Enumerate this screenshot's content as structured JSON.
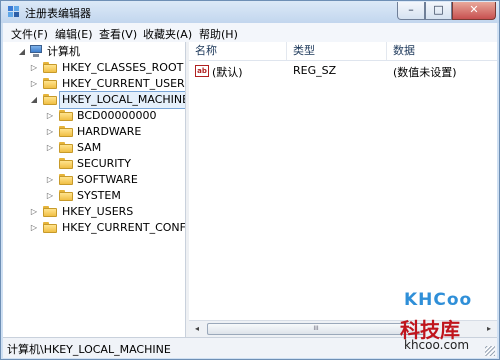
{
  "window": {
    "title": "注册表编辑器",
    "controls": {
      "minimize": "–",
      "maximize": "□",
      "close": "✕"
    }
  },
  "menu": [
    "文件(F)",
    "编辑(E)",
    "查看(V)",
    "收藏夹(A)",
    "帮助(H)"
  ],
  "tree": {
    "root": "计算机",
    "hives": [
      "HKEY_CLASSES_ROOT",
      "HKEY_CURRENT_USER",
      "HKEY_LOCAL_MACHINE",
      "HKEY_USERS",
      "HKEY_CURRENT_CONFIG"
    ],
    "selected": "HKEY_LOCAL_MACHINE",
    "children": [
      "BCD00000000",
      "HARDWARE",
      "SAM",
      "SECURITY",
      "SOFTWARE",
      "SYSTEM"
    ]
  },
  "list": {
    "columns": [
      "名称",
      "类型",
      "数据"
    ],
    "rows": [
      {
        "icon": "ab",
        "name": "(默认)",
        "type": "REG_SZ",
        "data": "(数值未设置)"
      }
    ]
  },
  "scrollbar": {
    "left": "◂",
    "right": "▸",
    "thumb": "III"
  },
  "status": "计算机\\HKEY_LOCAL_MACHINE",
  "watermark": {
    "logo": "KHCoo",
    "name": "科技库",
    "url": "khcoo.com"
  },
  "icons": {
    "collapsed": "▷",
    "expanded": "◢"
  }
}
